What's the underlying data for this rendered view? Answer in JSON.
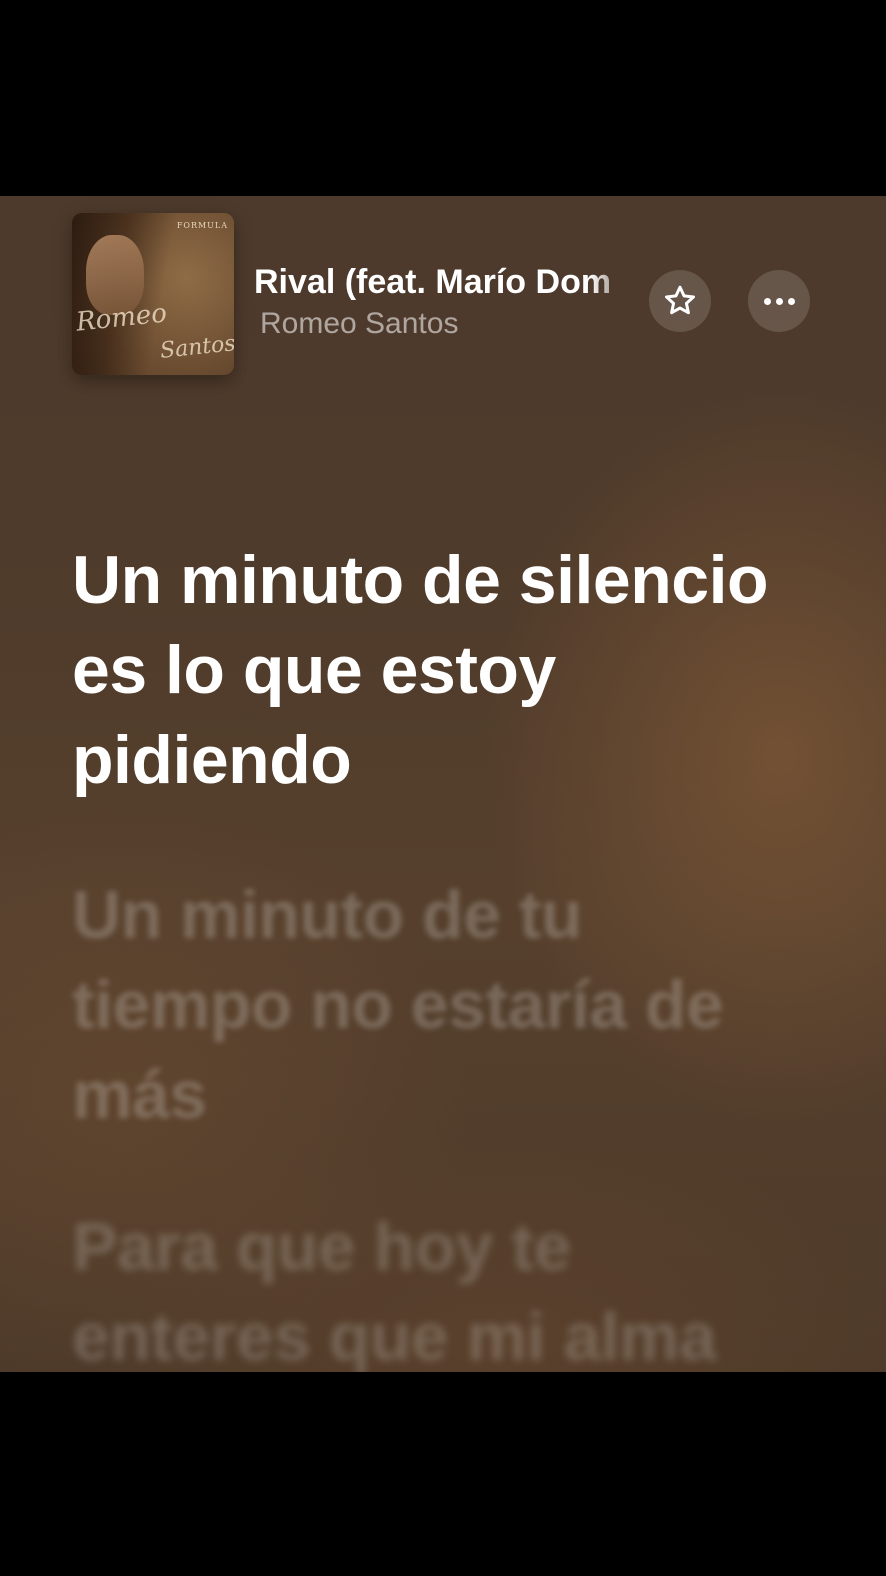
{
  "now_playing": {
    "title": "Rival (feat. Marío Dom",
    "artist": "Romeo Santos",
    "album_art": {
      "script_line1": "Romeo",
      "script_line2": "Santos",
      "badge": "FORMULA"
    }
  },
  "controls": {
    "favorite_icon": "star-outline-icon",
    "more_icon": "ellipsis-icon"
  },
  "lyrics": {
    "active": "Un minuto de silencio es lo que estoy pidiendo",
    "next": "Un minuto de tu tiempo no estaría de más",
    "after": "Para que hoy te enteres que mi alma"
  },
  "colors": {
    "background": "#4f3b2b",
    "active_text": "#ffffff",
    "inactive_text": "rgba(255,255,255,0.22)"
  }
}
